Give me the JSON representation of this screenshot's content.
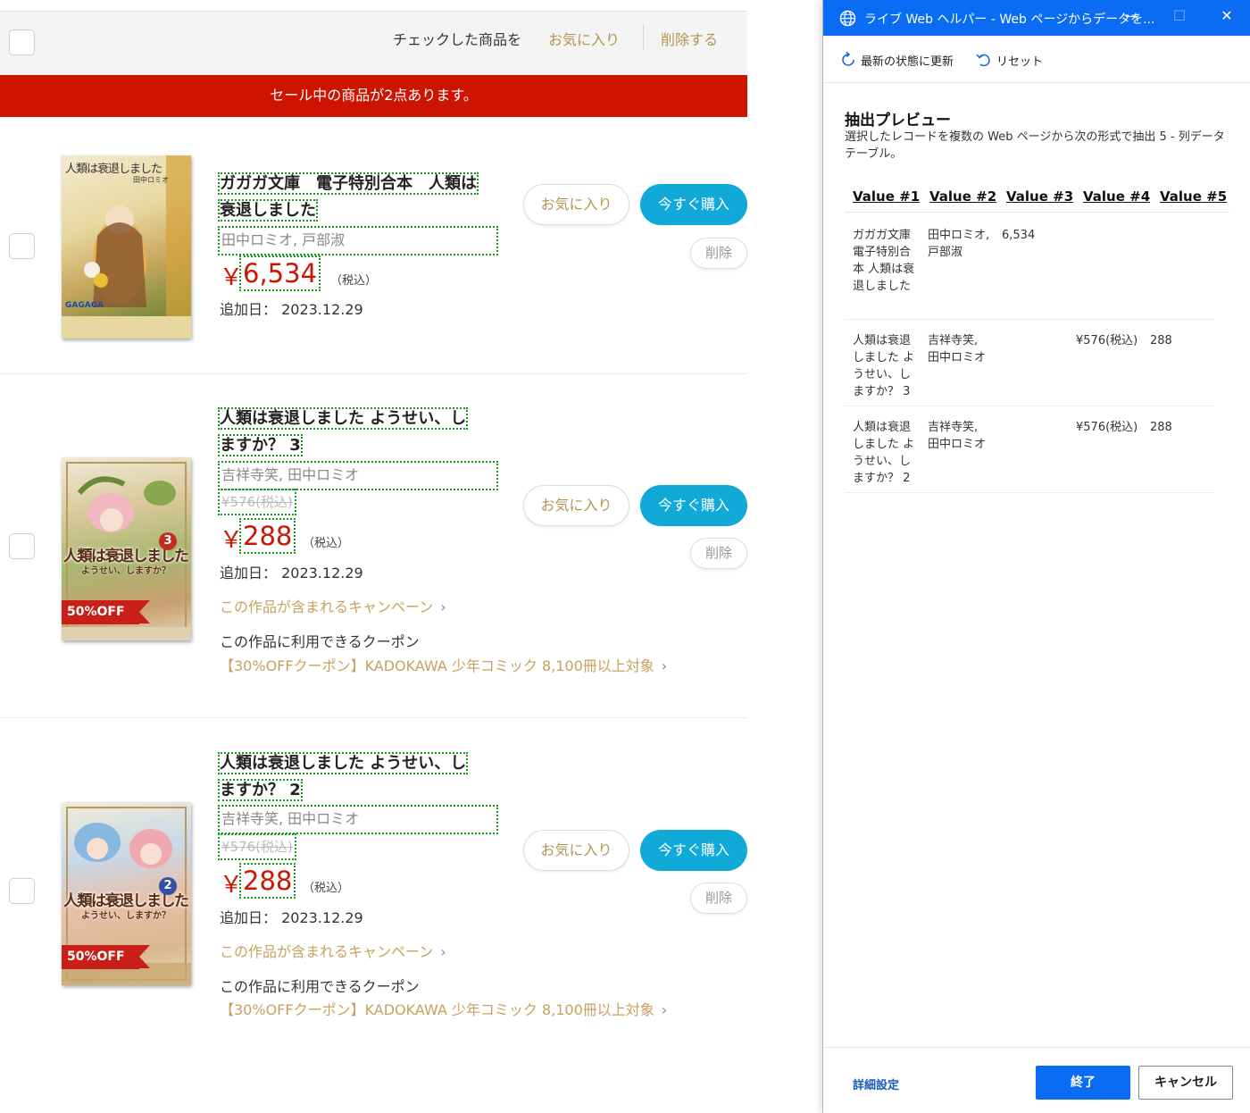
{
  "cart": {
    "toolbar": {
      "checked_label": "チェックした商品を",
      "favorite_label": "お気に入り",
      "delete_label": "削除する"
    },
    "sale_banner": "セール中の商品が2点あります。",
    "items": [
      {
        "title": "ガガガ文庫　電子特別合本　人類は衰退しました",
        "title_line1": "ガガガ文庫　電子特別合本　人類は",
        "title_line2": "衰退しました",
        "author": "田中ロミオ, 戸部淑",
        "original_price": "",
        "yen": "￥",
        "price": "6,534",
        "tax": "（税込）",
        "added": "追加日：  2023.12.29",
        "campaign": "",
        "coupon_head": "",
        "coupon": "",
        "cover_title": "人類は衰退しました",
        "cover_sub": "田中ロミオ",
        "cover_brand": "GAGAGA",
        "cover_volume": "",
        "discount_badge": "",
        "favorite_label": "お気に入り",
        "buy_label": "今すぐ購入",
        "delete_label": "削除"
      },
      {
        "title": "人類は衰退しました ようせい、しますか？ 3",
        "title_line1": "人類は衰退しました ようせい、し",
        "title_line2": "ますか？ 3",
        "author": "吉祥寺笑, 田中ロミオ",
        "original_price": "¥576(税込)",
        "yen": "￥",
        "price": "288",
        "tax": "（税込）",
        "added": "追加日：  2023.12.29",
        "campaign": "この作品が含まれるキャンペーン",
        "coupon_head": "この作品に利用できるクーポン",
        "coupon": "【30%OFFクーポン】KADOKAWA 少年コミック 8,100冊以上対象",
        "cover_title": "人類は衰退しました",
        "cover_sub": "ようせい、しますか？",
        "cover_volume": "3",
        "discount_badge": "50%OFF",
        "favorite_label": "お気に入り",
        "buy_label": "今すぐ購入",
        "delete_label": "削除"
      },
      {
        "title": "人類は衰退しました ようせい、しますか？ 2",
        "title_line1": "人類は衰退しました ようせい、し",
        "title_line2": "ますか？ 2",
        "author": "吉祥寺笑, 田中ロミオ",
        "original_price": "¥576(税込)",
        "yen": "￥",
        "price": "288",
        "tax": "（税込）",
        "added": "追加日：  2023.12.29",
        "campaign": "この作品が含まれるキャンペーン",
        "coupon_head": "この作品に利用できるクーポン",
        "coupon": "【30%OFFクーポン】KADOKAWA 少年コミック 8,100冊以上対象",
        "cover_title": "人類は衰退しました",
        "cover_sub": "ようせい、しますか？",
        "cover_volume": "2",
        "discount_badge": "50%OFF",
        "favorite_label": "お気に入り",
        "buy_label": "今すぐ購入",
        "delete_label": "削除"
      }
    ]
  },
  "helper": {
    "title": "ライブ Web ヘルパー - Web ページからデータを...",
    "refresh_label": "最新の状態に更新",
    "reset_label": "リセット",
    "preview_title": "抽出プレビュー",
    "preview_desc": "選択したレコードを複数の Web ページから次の形式で抽出 5 - 列データ テーブル。",
    "columns": [
      "Value #1",
      "Value #2",
      "Value #3",
      "Value #4",
      "Value #5"
    ],
    "rows": [
      [
        "ガガガ文庫 電子特別合本 人類は衰退しました",
        "田中ロミオ, 戸部淑",
        "6,534",
        "",
        ""
      ],
      [
        "人類は衰退しました ようせい、しますか？ 3",
        "吉祥寺笑, 田中ロミオ",
        "",
        "¥576(税込)",
        "288"
      ],
      [
        "人類は衰退しました ようせい、しますか？ 2",
        "吉祥寺笑, 田中ロミオ",
        "",
        "¥576(税込)",
        "288"
      ]
    ],
    "advanced_label": "詳細設定",
    "finish_label": "終了",
    "cancel_label": "キャンセル",
    "accent_color": "#0a6cf2"
  }
}
